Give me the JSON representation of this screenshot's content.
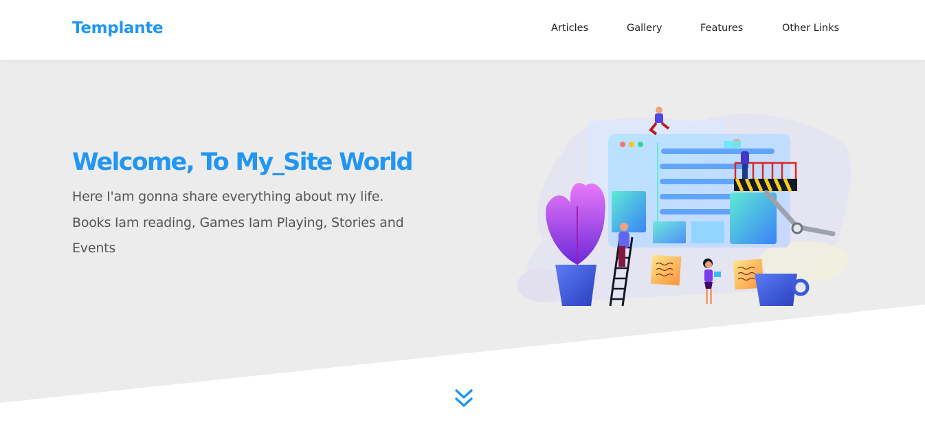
{
  "brand": {
    "name": "Templante",
    "color": "#2196f3"
  },
  "nav": {
    "items": [
      {
        "label": "Articles"
      },
      {
        "label": "Gallery"
      },
      {
        "label": "Features"
      },
      {
        "label": "Other Links"
      }
    ]
  },
  "hero": {
    "title": "Welcome, To My_Site World",
    "text": "Here I'am gonna share everything about my life. Books Iam reading, Games Iam Playing, Stories and Events",
    "background": "#ececec",
    "illustration_icon": "web-builders-illustration"
  },
  "scroll": {
    "icon": "double-chevron-down-icon"
  }
}
